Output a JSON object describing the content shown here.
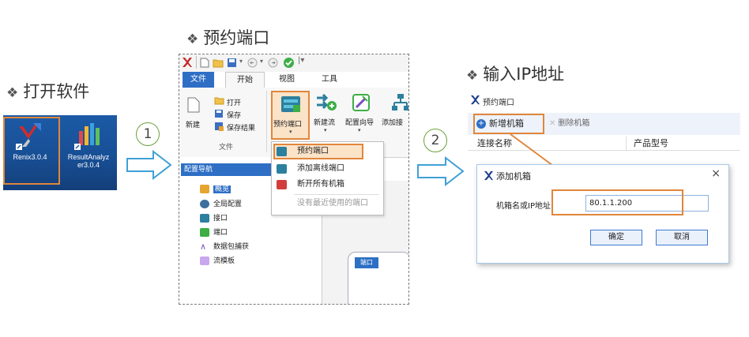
{
  "steps": {
    "open_software": "打开软件",
    "reserve_port": "预约端口",
    "enter_ip": "输入IP地址",
    "step1": "1",
    "step2": "2",
    "bullet": "❖"
  },
  "desktop": {
    "icons": [
      {
        "name": "renix",
        "label": "Renix3.0.4"
      },
      {
        "name": "result-analyzer",
        "label": "ResultAnalyz er3.0.4"
      }
    ]
  },
  "software": {
    "tabs": {
      "file": "文件",
      "start": "开始",
      "view": "视图",
      "tools": "工具"
    },
    "ribbon": {
      "open": "打开",
      "save": "保存",
      "save_result": "保存结果",
      "new": "新建",
      "group_file": "文件",
      "reserve_port": "预约端口",
      "new_stream": "新建流",
      "config_wizard": "配置向导",
      "add": "添加接"
    },
    "menu": {
      "reserve_port": "预约端口",
      "add_offline_port": "添加离线端口",
      "disconnect_all": "断开所有机箱",
      "no_recent": "没有最近使用的端口"
    },
    "nav": {
      "header": "配置导航",
      "items": [
        "概览",
        "全局配置",
        "接口",
        "端口",
        "数据包捕获",
        "流模板"
      ]
    },
    "port_tab": "端口"
  },
  "right": {
    "window_title": "预约端口",
    "add_chassis": "新增机箱",
    "delete_chassis": "删除机箱",
    "col_connection": "连接名称",
    "col_product": "产品型号",
    "dialog": {
      "title": "添加机箱",
      "field_label": "机箱名或IP地址",
      "field_value": "80.1.1.200",
      "ok": "确定",
      "cancel": "取消",
      "close": "×"
    }
  },
  "colors": {
    "accent_blue": "#2e6fc5",
    "highlight_orange": "#e1863b",
    "arrow_blue": "#3fa0d8",
    "step_green": "#6aa13c"
  }
}
